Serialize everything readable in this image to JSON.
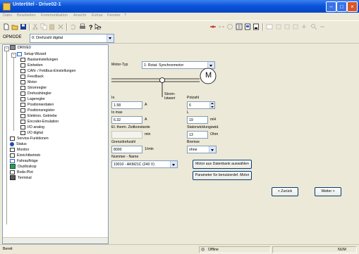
{
  "window": {
    "title": "Untertitel - Drive02-1"
  },
  "menu": [
    "Datei",
    "Bearbeiten",
    "Kommunikation",
    "Ansicht",
    "Extras",
    "Fenster",
    "?"
  ],
  "opmode": {
    "label": "OPMODE",
    "value": "0: Drehzahl digital"
  },
  "tree": {
    "root": "DRIVE0",
    "wizard": "Setup-Wizard",
    "wizard_items": [
      "Basiseinstellungen",
      "Einheiten",
      "CAN- / Feldbus-Einstellungen",
      "Feedback",
      "Motor",
      "Stromregler",
      "Drehzahlregler",
      "Lageregler",
      "Positionierdaten",
      "Positionsregister",
      "Elektron. Getriebe",
      "Encoder-Emulation",
      "I/O analog",
      "I/O digital"
    ],
    "other_items": [
      "Service-Funktionen",
      "Status",
      "Monitor",
      "Einrichtbetrieb",
      "Fahraufträge",
      "Oszilloskop",
      "Bode-Plot",
      "Terminal"
    ]
  },
  "form": {
    "motortyp_label": "Motor-Typ",
    "motortyp_value": "1: Rotat. Synchronmotor",
    "motor_symbol": "M",
    "strom_ist_label": "Strom-\nIstwert",
    "io_label": "Io",
    "io_value": "1.58",
    "io_unit": "A",
    "polzahl_label": "Polzahl",
    "polzahl_value": "6",
    "iomax_label": "Io max",
    "iomax_value": "6.32",
    "iomax_unit": "A",
    "l_label": "L",
    "l_value": "19",
    "l_unit": "mH",
    "el_label": "El. therm. Zeitkonstante",
    "el_value": "",
    "el_unit": "min",
    "stator_label": "Statorwicklungswid.",
    "stator_value": "13",
    "stator_unit": "Ohm",
    "grenz_label": "Grenzdrehzahl",
    "grenz_value": "8000",
    "grenz_unit": "1/min",
    "bremse_label": "Bremse",
    "bremse_value": "ohne",
    "nummer_label": "Nummer - Name",
    "nummer_value": "19010 - AKM21C (240 V)",
    "btn_datenbank": "Motor aus Datenbank auswählen",
    "btn_parameter": "Parameter für benutzerdef. Motor",
    "btn_back": "< Zurück",
    "btn_next": "Weiter >"
  },
  "status": {
    "left": "Bereit",
    "mode": "Offline",
    "right": "NUM"
  }
}
